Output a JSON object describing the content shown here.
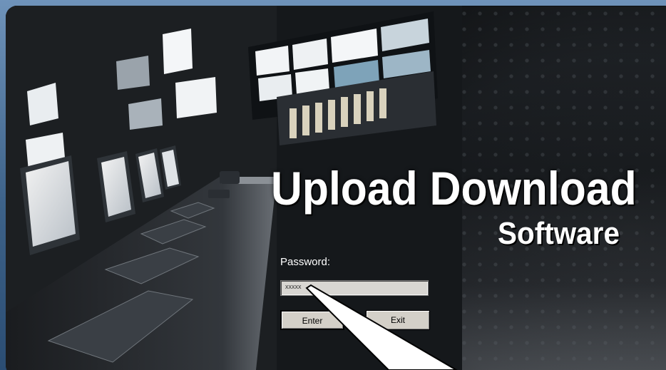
{
  "app": {
    "title": "Upload Download",
    "subtitle": "Software"
  },
  "login": {
    "password_label": "Password:",
    "password_value": "xxxxx",
    "enter_label": "Enter",
    "exit_label": "Exit"
  },
  "colors": {
    "background": "#3d6289",
    "panel": "#1f2225",
    "text": "#ffffff",
    "button_face": "#d4d0c8"
  }
}
